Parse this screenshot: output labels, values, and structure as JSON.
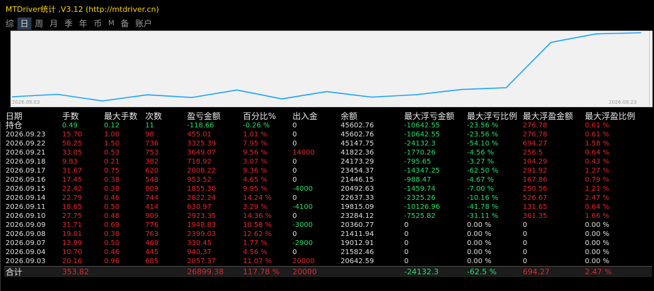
{
  "window": {
    "title": "MTDriver统计 ,V3.12 (http://mtdriver.cn)"
  },
  "tabs": [
    "综",
    "日",
    "周",
    "月",
    "季",
    "年",
    "币",
    "M",
    "备",
    "账户"
  ],
  "chart": {
    "x_start_label": "2026.09.03",
    "x_end_label": "2026.09.23",
    "line_color": "#1aa3ff",
    "background": "#f1f1f1"
  },
  "chart_data": {
    "type": "line",
    "x": [
      "2026.09.03",
      "2026.09.04",
      "2026.09.07",
      "2026.09.08",
      "2026.09.09",
      "2026.09.10",
      "2026.09.11",
      "2026.09.14",
      "2026.09.15",
      "2026.09.16",
      "2026.09.17",
      "2026.09.18",
      "2026.09.21",
      "2026.09.22",
      "2026.09.23"
    ],
    "y": [
      20642.59,
      21582.46,
      19012.91,
      21411.94,
      20360.77,
      23284.12,
      19815.09,
      22637.33,
      20492.63,
      21446.15,
      23454.37,
      24173.29,
      41822.36,
      45147.75,
      45602.76
    ]
  },
  "table": {
    "headers": [
      "日期",
      "手数",
      "最大手数",
      "次数",
      "盈亏金额",
      "百分比%",
      "出入金",
      "余额",
      "最大浮亏金额",
      "最大浮亏比例",
      "最大浮盈金额",
      "最大浮盈比例"
    ],
    "holding": {
      "label": "持仓",
      "cells": [
        "0.49",
        "0.12",
        "11",
        "-118.66",
        "-0.26 %",
        "0",
        "45602.76",
        "-10642.55",
        "-23.56 %",
        "276.78",
        "0.61 %"
      ]
    },
    "rows": [
      [
        "2026.09.23",
        "15.70",
        "1.00",
        "98",
        "455.01",
        "1.01 %",
        "0",
        "45602.76",
        "-10642.55",
        "-23.56 %",
        "276.78",
        "0.61 %"
      ],
      [
        "2026.09.22",
        "58.25",
        "1.50",
        "736",
        "3325.39",
        "7.95 %",
        "0",
        "45147.75",
        "-24132.3",
        "-54.10 %",
        "694.27",
        "1.58 %"
      ],
      [
        "2026.09.21",
        "33.05",
        "0.53",
        "753",
        "3649.07",
        "9.56 %",
        "14000",
        "41822.36",
        "-1770.26",
        "-4.56 %",
        "256.5",
        "0.64 %"
      ],
      [
        "2026.09.18",
        "9.83",
        "0.21",
        "382",
        "718.92",
        "3.07 %",
        "0",
        "24173.29",
        "-795.65",
        "-3.27 %",
        "104.29",
        "0.43 %"
      ],
      [
        "2026.09.17",
        "31.67",
        "0.75",
        "620",
        "2008.22",
        "9.36 %",
        "0",
        "23454.37",
        "-14347.25",
        "-62.50 %",
        "291.92",
        "1.27 %"
      ],
      [
        "2026.09.16",
        "17.45",
        "0.38",
        "548",
        "953.52",
        "4.65 %",
        "0",
        "21446.15",
        "-988.47",
        "-4.67 %",
        "167.86",
        "0.79 %"
      ],
      [
        "2026.09.15",
        "22.42",
        "0.38",
        "809",
        "1855.30",
        "9.95 %",
        "-4000",
        "20492.63",
        "-1459.74",
        "-7.00 %",
        "250.56",
        "1.21 %"
      ],
      [
        "2026.09.14",
        "22.79",
        "0.46",
        "744",
        "2822.24",
        "14.24 %",
        "0",
        "22637.33",
        "-2325.26",
        "-10.16 %",
        "526.67",
        "2.47 %"
      ],
      [
        "2026.09.11",
        "18.65",
        "0.50",
        "414",
        "630.97",
        "3.29 %",
        "-4100",
        "19815.09",
        "-10126.96",
        "-41.78 %",
        "131.65",
        "0.64 %"
      ],
      [
        "2026.09.10",
        "27.75",
        "0.48",
        "909",
        "2923.35",
        "14.36 %",
        "0",
        "23284.12",
        "-7525.82",
        "-31.11 %",
        "361.35",
        "1.66 %"
      ],
      [
        "2026.09.09",
        "31.71",
        "0.69",
        "776",
        "1948.83",
        "10.58 %",
        "-3000",
        "20360.77",
        "0",
        "0.00 %",
        "0",
        "0.00 %"
      ],
      [
        "2026.09.08",
        "19.01",
        "0.38",
        "763",
        "2399.03",
        "12.62 %",
        "0",
        "21411.94",
        "0",
        "0.00 %",
        "0",
        "0.00 %"
      ],
      [
        "2026.09.07",
        "13.99",
        "0.50",
        "469",
        "330.45",
        "1.77 %",
        "-2900",
        "19012.91",
        "0",
        "0.00 %",
        "0",
        "0.00 %"
      ],
      [
        "2026.09.04",
        "10.70",
        "0.46",
        "445",
        "940.37",
        "4.56 %",
        "0",
        "21582.46",
        "0",
        "0.00 %",
        "0",
        "0.00 %"
      ],
      [
        "2026.09.03",
        "20.16",
        "0.96",
        "685",
        "2057.37",
        "11.07 %",
        "20000",
        "20642.59",
        "0",
        "0.00 %",
        "0",
        "0.00 %"
      ]
    ],
    "total": {
      "label": "合计",
      "cells": [
        "353.82",
        "",
        "",
        "26899.38",
        "117.78 %",
        "20000",
        "",
        "-24132.3",
        "-62.5 %",
        "694.27",
        "2.47 %"
      ]
    }
  },
  "colors": {
    "positive": "#e8252b",
    "negative": "#22e06a",
    "neutral": "#e0e0e0",
    "title": "#ffd400"
  }
}
